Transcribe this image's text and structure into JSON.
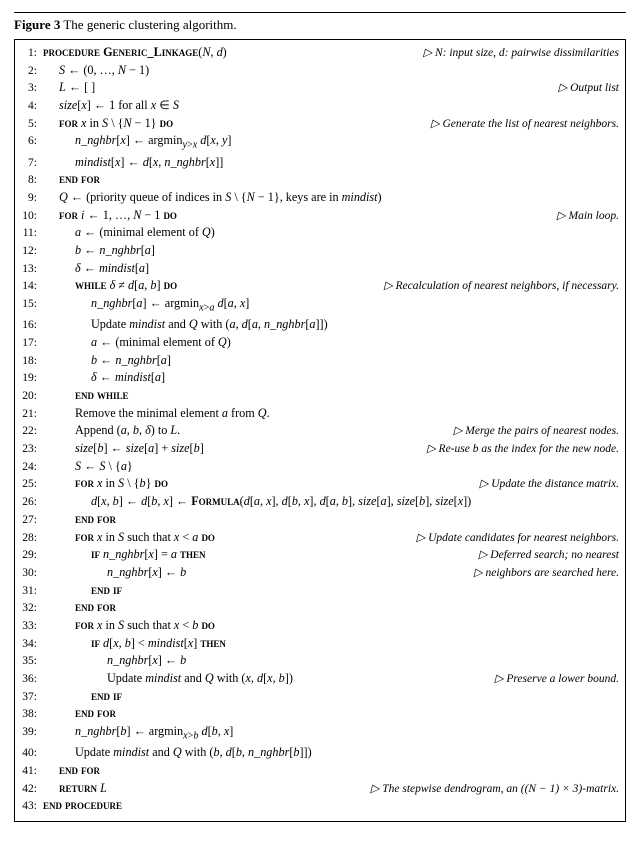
{
  "figure": {
    "caption": "Figure 3",
    "caption_text": "The generic clustering algorithm.",
    "lines": [
      {
        "num": "1:",
        "indent": 0,
        "text": "procedure GENERIC_LINKAGE(N, d)",
        "comment": "▷ N: input size, d: pairwise dissimilarities"
      },
      {
        "num": "2:",
        "indent": 1,
        "text": "S ← (0, …, N − 1)"
      },
      {
        "num": "3:",
        "indent": 1,
        "text": "L ← [ ]",
        "comment": "▷ Output list"
      },
      {
        "num": "4:",
        "indent": 1,
        "text": "size[x] ← 1 for all x ∈ S"
      },
      {
        "num": "5:",
        "indent": 1,
        "text": "for x in S \\ {N − 1} do",
        "comment": "▷ Generate the list of nearest neighbors."
      },
      {
        "num": "6:",
        "indent": 2,
        "text": "n_nghbr[x] ← argmin_{y>x} d[x, y]"
      },
      {
        "num": "7:",
        "indent": 2,
        "text": "mindist[x] ← d[x, n_nghbr[x]]"
      },
      {
        "num": "8:",
        "indent": 1,
        "text": "end for"
      },
      {
        "num": "9:",
        "indent": 1,
        "text": "Q ← (priority queue of indices in S \\ {N − 1}, keys are in mindist)"
      },
      {
        "num": "10:",
        "indent": 1,
        "text": "for i ← 1, …, N − 1 do",
        "comment": "▷ Main loop."
      },
      {
        "num": "11:",
        "indent": 2,
        "text": "a ← (minimal element of Q)"
      },
      {
        "num": "12:",
        "indent": 2,
        "text": "b ← n_nghbr[a]"
      },
      {
        "num": "13:",
        "indent": 2,
        "text": "δ ← mindist[a]"
      },
      {
        "num": "14:",
        "indent": 2,
        "text": "while δ ≠ d[a, b] do",
        "comment": "▷ Recalculation of nearest neighbors, if necessary."
      },
      {
        "num": "15:",
        "indent": 3,
        "text": "n_nghbr[a] ← argmin_{x>a} d[a, x]"
      },
      {
        "num": "16:",
        "indent": 3,
        "text": "Update mindist and Q with (a, d[a, n_nghbr[a]])"
      },
      {
        "num": "17:",
        "indent": 3,
        "text": "a ← (minimal element of Q)"
      },
      {
        "num": "18:",
        "indent": 3,
        "text": "b ← n_nghbr[a]"
      },
      {
        "num": "19:",
        "indent": 3,
        "text": "δ ← mindist[a]"
      },
      {
        "num": "20:",
        "indent": 2,
        "text": "end while"
      },
      {
        "num": "21:",
        "indent": 2,
        "text": "Remove the minimal element a from Q."
      },
      {
        "num": "22:",
        "indent": 2,
        "text": "Append (a, b, δ) to L.",
        "comment": "▷ Merge the pairs of nearest nodes."
      },
      {
        "num": "23:",
        "indent": 2,
        "text": "size[b] ← size[a] + size[b]",
        "comment": "▷ Re-use b as the index for the new node."
      },
      {
        "num": "24:",
        "indent": 2,
        "text": "S ← S \\ {a}"
      },
      {
        "num": "25:",
        "indent": 2,
        "text": "for x in S \\ {b} do",
        "comment": "▷ Update the distance matrix."
      },
      {
        "num": "26:",
        "indent": 3,
        "text": "d[x, b] ← d[b, x] ← FORMULA(d[a, x], d[b, x], d[a, b], size[a], size[b], size[x])"
      },
      {
        "num": "27:",
        "indent": 2,
        "text": "end for"
      },
      {
        "num": "28:",
        "indent": 2,
        "text": "for x in S such that x < a do",
        "comment": "▷ Update candidates for nearest neighbors."
      },
      {
        "num": "29:",
        "indent": 3,
        "text": "if n_nghbr[x] = a then",
        "comment": "▷ Deferred search; no nearest"
      },
      {
        "num": "30:",
        "indent": 4,
        "text": "n_nghbr[x] ← b",
        "comment": "▷ neighbors are searched here."
      },
      {
        "num": "31:",
        "indent": 3,
        "text": "end if"
      },
      {
        "num": "32:",
        "indent": 2,
        "text": "end for"
      },
      {
        "num": "33:",
        "indent": 2,
        "text": "for x in S such that x < b do"
      },
      {
        "num": "34:",
        "indent": 3,
        "text": "if d[x, b] < mindist[x] then"
      },
      {
        "num": "35:",
        "indent": 4,
        "text": "n_nghbr[x] ← b"
      },
      {
        "num": "36:",
        "indent": 4,
        "text": "Update mindist and Q with (x, d[x, b])",
        "comment": "▷ Preserve a lower bound."
      },
      {
        "num": "37:",
        "indent": 3,
        "text": "end if"
      },
      {
        "num": "38:",
        "indent": 2,
        "text": "end for"
      },
      {
        "num": "39:",
        "indent": 2,
        "text": "n_nghbr[b] ← argmin_{x>b} d[b, x]"
      },
      {
        "num": "40:",
        "indent": 2,
        "text": "Update mindist and Q with (b, d[b, n_nghbr[b]])"
      },
      {
        "num": "41:",
        "indent": 1,
        "text": "end for"
      },
      {
        "num": "42:",
        "indent": 1,
        "text": "return L",
        "comment": "▷ The stepwise dendrogram, an ((N − 1) × 3)-matrix."
      },
      {
        "num": "43:",
        "indent": 0,
        "text": "end procedure"
      }
    ]
  }
}
